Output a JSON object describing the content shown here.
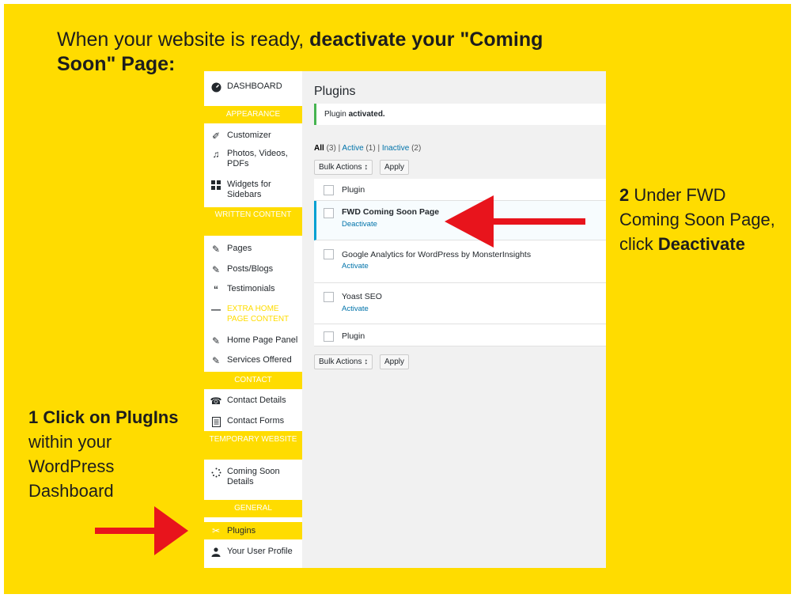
{
  "headline": {
    "normal": "When your website is ready, ",
    "bold": "deactivate your \"Coming Soon\" Page:"
  },
  "sidebar": {
    "dashboard": "DASHBOARD",
    "sections": {
      "appearance": "APPEARANCE",
      "written": "WRITTEN CONTENT",
      "contact": "CONTACT",
      "temporary": "TEMPORARY WEBSITE",
      "general": "GENERAL"
    },
    "items": {
      "customizer": "Customizer",
      "photos": "Photos, Videos, PDFs",
      "widgets": "Widgets for Sidebars",
      "pages": "Pages",
      "posts": "Posts/Blogs",
      "testimonials": "Testimonials",
      "extra": "EXTRA HOME PAGE CONTENT",
      "homepanel": "Home Page Panel",
      "services": "Services Offered",
      "contact_details": "Contact Details",
      "contact_forms": "Contact Forms",
      "coming_soon": "Coming Soon Details",
      "plugins": "Plugins",
      "profile": "Your User Profile"
    }
  },
  "main": {
    "title": "Plugins",
    "notice_prefix": "Plugin ",
    "notice_bold": "activated.",
    "filters": {
      "all": "All",
      "all_count": "(3)",
      "active": "Active",
      "active_count": "(1)",
      "inactive": "Inactive",
      "inactive_count": "(2)",
      "sep": "|"
    },
    "bulk_label": "Bulk Actions ↕",
    "apply_label": "Apply",
    "column_header": "Plugin",
    "plugins": [
      {
        "name": "FWD Coming Soon Page",
        "action": "Deactivate"
      },
      {
        "name": "Google Analytics for WordPress by MonsterInsights",
        "action": "Activate"
      },
      {
        "name": "Yoast SEO",
        "action": "Activate"
      }
    ]
  },
  "annotations": {
    "right": {
      "num": "2",
      "text1": " Under FWD Coming Soon Page, click ",
      "bold": "Deactivate"
    },
    "left": {
      "bold": "1 Click on PlugIns",
      "text": "within your WordPress Dashboard"
    }
  },
  "colors": {
    "accent": "#FFDC00",
    "arrow": "#E8141C",
    "link": "#0073aa",
    "active_border": "#00a0d2"
  }
}
